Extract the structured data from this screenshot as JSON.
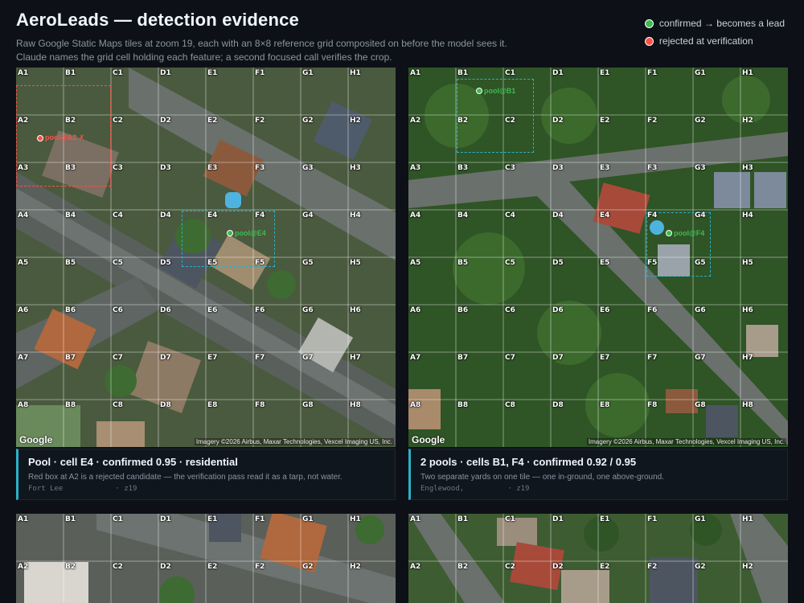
{
  "header": {
    "title": "AeroLeads — detection evidence",
    "subtitle_line1": "Raw Google Static Maps tiles at zoom 19, each with an 8×8 reference grid composited on before the model sees it.",
    "subtitle_line2": "Claude names the grid cell holding each feature; a second focused call verifies the crop."
  },
  "legend": {
    "confirmed": "confirmed → becomes a lead",
    "rejected": "rejected at verification",
    "confirmed_color": "#3fb950",
    "rejected_color": "#f85149"
  },
  "attribution": {
    "google": "Google",
    "imagery": "Imagery ©2026 Airbus, Maxar Technologies, Vexcel Imaging US, Inc."
  },
  "grid": {
    "cols": [
      "A",
      "B",
      "C",
      "D",
      "E",
      "F",
      "G",
      "H"
    ],
    "rows": [
      "1",
      "2",
      "3",
      "4",
      "5",
      "6",
      "7",
      "8"
    ]
  },
  "tiles": [
    {
      "markers": [
        {
          "label": "pool@A2 ✗",
          "status": "rejected"
        },
        {
          "label": "pool@E4",
          "status": "confirmed"
        }
      ],
      "card": {
        "title": "Pool · cell E4 · confirmed 0.95 · residential",
        "desc": "Red box at A2 is a rejected candidate — the verification pass read it as a tarp, not water.",
        "location": "Fort Lee",
        "zoom": "z19"
      }
    },
    {
      "markers": [
        {
          "label": "pool@B1",
          "status": "confirmed"
        },
        {
          "label": "pool@F4",
          "status": "confirmed"
        }
      ],
      "card": {
        "title": "2 pools · cells B1, F4 · confirmed 0.92 / 0.95",
        "desc": "Two separate yards on one tile — one in-ground, one above-ground.",
        "location": "Englewood,",
        "zoom": "z19"
      }
    }
  ]
}
